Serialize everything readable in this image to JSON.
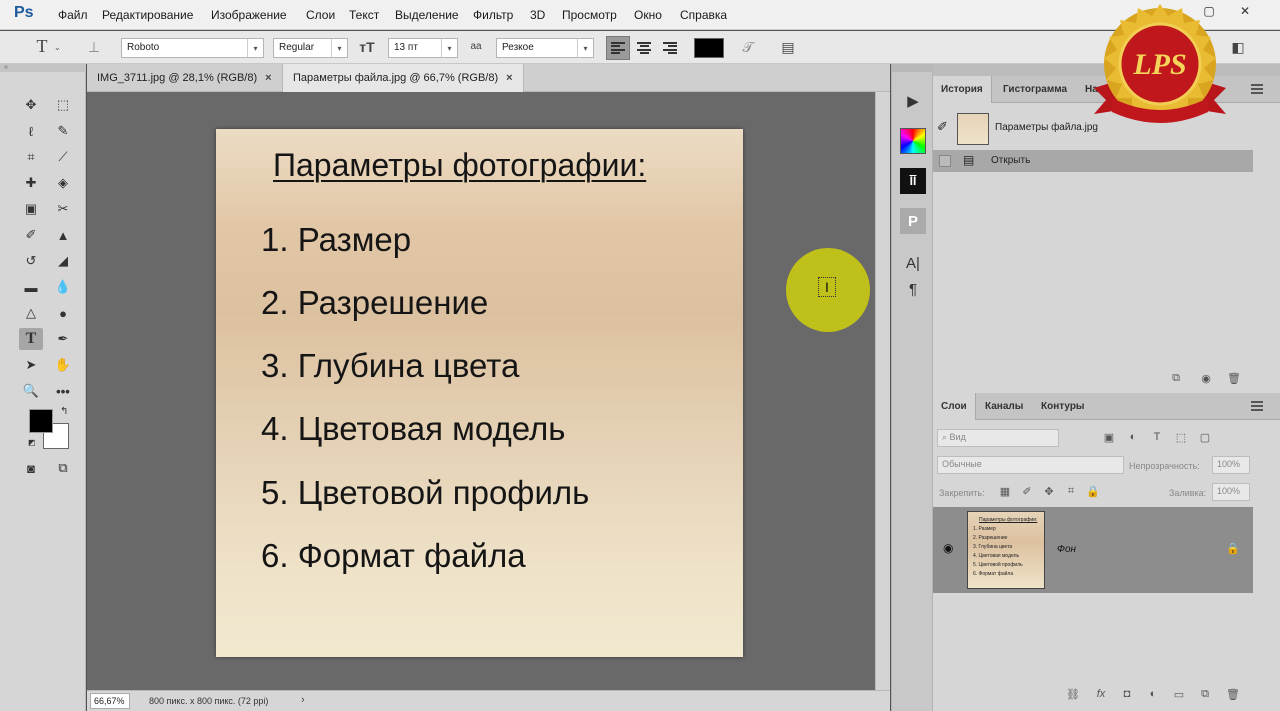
{
  "app": {
    "logo": "Ps"
  },
  "menu": [
    "Файл",
    "Редактирование",
    "Изображение",
    "Слои",
    "Текст",
    "Выделение",
    "Фильтр",
    "3D",
    "Просмотр",
    "Окно",
    "Справка"
  ],
  "options": {
    "font_family": "Roboto",
    "font_style": "Regular",
    "font_size": "13 пт",
    "antialias_icon": "aa",
    "antialias": "Резкое",
    "color": "#000000"
  },
  "tabs": [
    {
      "label": "IMG_3711.jpg @ 28,1% (RGB/8)",
      "active": false
    },
    {
      "label": "Параметры файла.jpg @ 66,7% (RGB/8)",
      "active": true
    }
  ],
  "document": {
    "title": "Параметры фотографии:",
    "items": [
      "1. Размер",
      "2. Разрешение",
      "3. Глубина цвета",
      "4. Цветовая модель",
      "5. Цветовой профиль",
      "6. Формат файла"
    ]
  },
  "status": {
    "zoom": "66,67%",
    "info": "800 пикс. x 800 пикс. (72 ppi)"
  },
  "history_panel": {
    "tabs": [
      "История",
      "Гистограмма",
      "Нав"
    ],
    "snapshot_label": "Параметры файла.jpg",
    "states": [
      "Открыть"
    ]
  },
  "layers_panel": {
    "tabs": [
      "Слои",
      "Каналы",
      "Контуры"
    ],
    "filter_placeholder": "Вид",
    "blend_mode": "Обычные",
    "opacity_label": "Непрозрачность:",
    "opacity": "100%",
    "lock_label": "Закрепить:",
    "fill_label": "Заливка:",
    "fill": "100%",
    "layer_name": "Фон"
  },
  "badge": {
    "text": "LPS"
  },
  "colors": {
    "foreground": "#000000",
    "background": "#ffffff",
    "cursor_highlight": "#c8c814"
  }
}
